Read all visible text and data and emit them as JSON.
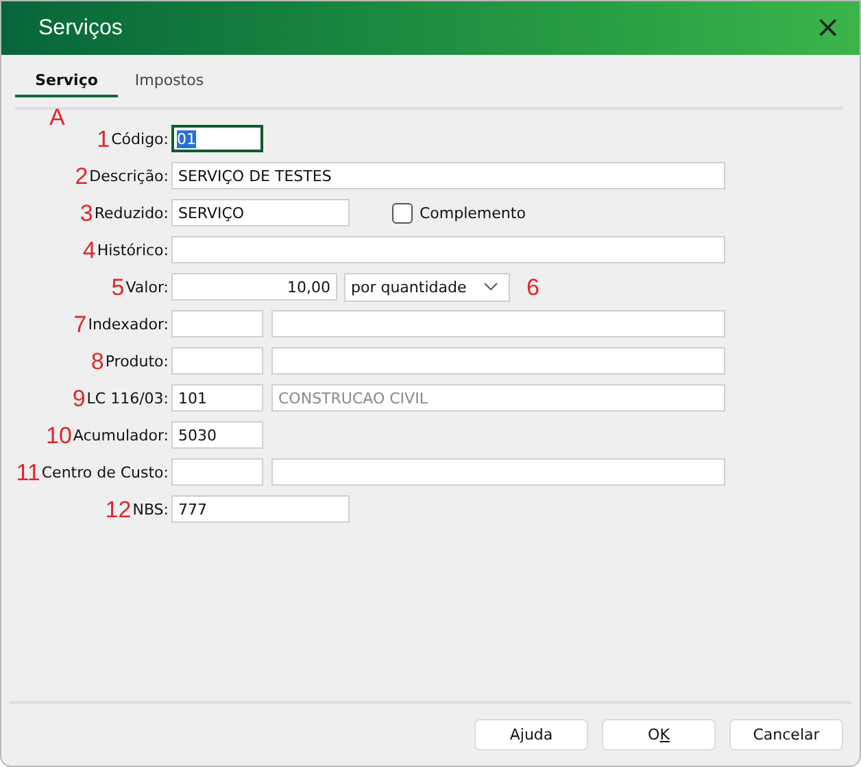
{
  "window": {
    "title": "Serviços",
    "close": "×"
  },
  "tabs": [
    {
      "label": "Serviço",
      "selected": true
    },
    {
      "label": "Impostos",
      "selected": false
    }
  ],
  "tab_marker": "A",
  "rows": [
    {
      "marker": "1",
      "label": "Código:",
      "kind": "short_text",
      "value": "01",
      "focused": true,
      "highlighted": true
    },
    {
      "marker": "2",
      "label": "Descrição:",
      "kind": "long_text",
      "value": "SERVIÇO DE TESTES"
    },
    {
      "marker": "3",
      "label": "Reduzido:",
      "kind": "check",
      "value": "SERVIÇO",
      "check_label": "Complemento",
      "checked": false
    },
    {
      "marker": "4",
      "label": "Histórico:",
      "kind": "long_text"
    },
    {
      "marker": "5",
      "label": "Valor:",
      "kind": "select",
      "value": "10,00",
      "option": "por quantidade",
      "after_marker": "6"
    },
    {
      "marker": "7",
      "label": "Indexador:",
      "kind": "pair"
    },
    {
      "marker": "8",
      "label": "Produto:",
      "kind": "pair"
    },
    {
      "marker": "9",
      "label": "LC 116/03:",
      "kind": "pair",
      "value": "101",
      "description": "CONSTRUCAO CIVIL"
    },
    {
      "marker": "10",
      "label": "Acumulador:",
      "kind": "short_text",
      "value": "5030"
    },
    {
      "marker": "11",
      "label": "Centro de Custo:",
      "kind": "pair"
    },
    {
      "marker": "12",
      "label": "NBS:",
      "kind": "medium_text",
      "value": "777"
    }
  ],
  "buttons": [
    {
      "label": "Ajuda"
    },
    {
      "label": "O",
      "underlined_key": "K"
    },
    {
      "label": "Cancelar"
    }
  ]
}
